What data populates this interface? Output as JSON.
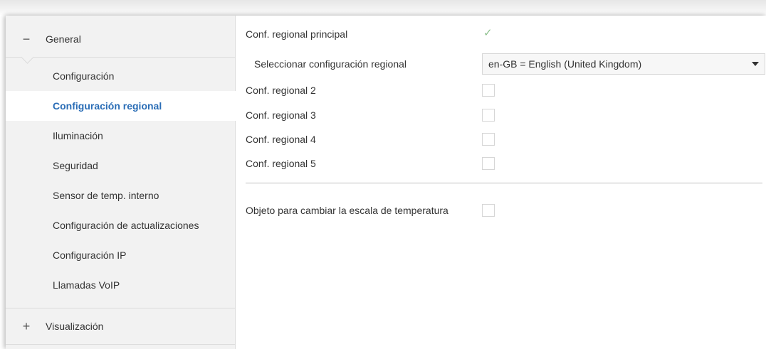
{
  "sidebar": {
    "groups": [
      {
        "sign": "−",
        "label": "General"
      },
      {
        "sign": "+",
        "label": "Visualización"
      }
    ],
    "items": [
      {
        "label": "Configuración",
        "active": false
      },
      {
        "label": "Configuración regional",
        "active": true
      },
      {
        "label": "Iluminación",
        "active": false
      },
      {
        "label": "Seguridad",
        "active": false
      },
      {
        "label": "Sensor de temp. interno",
        "active": false
      },
      {
        "label": "Configuración de actualizaciones",
        "active": false
      },
      {
        "label": "Configuración IP",
        "active": false
      },
      {
        "label": "Llamadas VoIP",
        "active": false
      }
    ]
  },
  "main": {
    "primary": {
      "label": "Conf. regional principal",
      "checked": true,
      "check_glyph": "✓"
    },
    "select_regional": {
      "label": "Seleccionar configuración regional",
      "value": "en-GB = English (United Kingdom)"
    },
    "regional_rows": [
      {
        "label": "Conf. regional 2",
        "checked": false
      },
      {
        "label": "Conf. regional 3",
        "checked": false
      },
      {
        "label": "Conf. regional 4",
        "checked": false
      },
      {
        "label": "Conf. regional 5",
        "checked": false
      }
    ],
    "temp_scale": {
      "label": "Objeto para cambiar la escala de temperatura",
      "checked": false
    }
  },
  "colors": {
    "accent": "#2a6db6",
    "check": "#8cc08c",
    "sidebar_bg": "#f2f2f2"
  }
}
